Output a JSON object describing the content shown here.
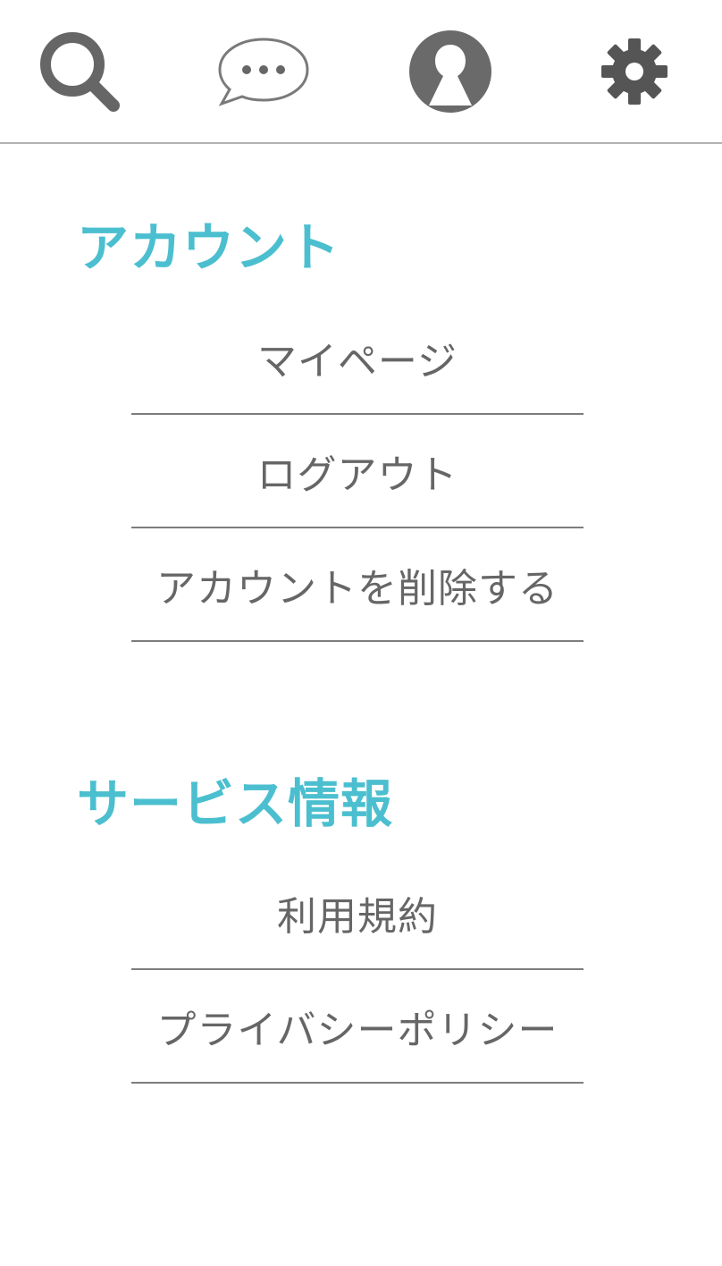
{
  "nav": {
    "items": [
      {
        "id": "search",
        "icon": "search-icon"
      },
      {
        "id": "messages",
        "icon": "chat-bubble-icon"
      },
      {
        "id": "account",
        "icon": "user-avatar-icon"
      },
      {
        "id": "settings",
        "icon": "gear-icon"
      }
    ],
    "icon_color": "#666666"
  },
  "sections": {
    "account": {
      "title": "アカウント",
      "items": [
        {
          "label": "マイページ"
        },
        {
          "label": "ログアウト"
        },
        {
          "label": "アカウントを削除する"
        }
      ]
    },
    "service": {
      "title": "サービス情報",
      "items": [
        {
          "label": "利用規約"
        },
        {
          "label": "プライバシーポリシー"
        }
      ]
    }
  },
  "colors": {
    "accent": "#4bbfcf",
    "text": "#666666",
    "divider": "#7d7d7d"
  }
}
